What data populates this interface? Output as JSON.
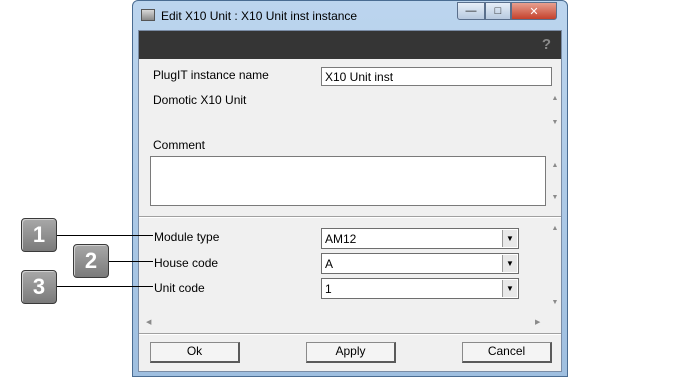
{
  "window": {
    "title": "Edit X10 Unit : X10 Unit inst instance",
    "controls": {
      "minimize": "—",
      "maximize": "□",
      "close": "✕"
    }
  },
  "header": {
    "help_icon": "?"
  },
  "form": {
    "instance_name_label": "PlugIT instance name",
    "instance_name_value": "X10 Unit inst",
    "type_label": "Domotic X10 Unit",
    "comment_label": "Comment",
    "comment_value": "",
    "module_type_label": "Module type",
    "module_type_value": "AM12",
    "house_code_label": "House code",
    "house_code_value": "A",
    "unit_code_label": "Unit code",
    "unit_code_value": "1"
  },
  "buttons": {
    "ok": "Ok",
    "apply": "Apply",
    "cancel": "Cancel"
  },
  "callouts": [
    "1",
    "2",
    "3"
  ],
  "glyphs": {
    "up": "▲",
    "down": "▼",
    "left": "◀",
    "right": "▶",
    "dropdown": "▼"
  }
}
